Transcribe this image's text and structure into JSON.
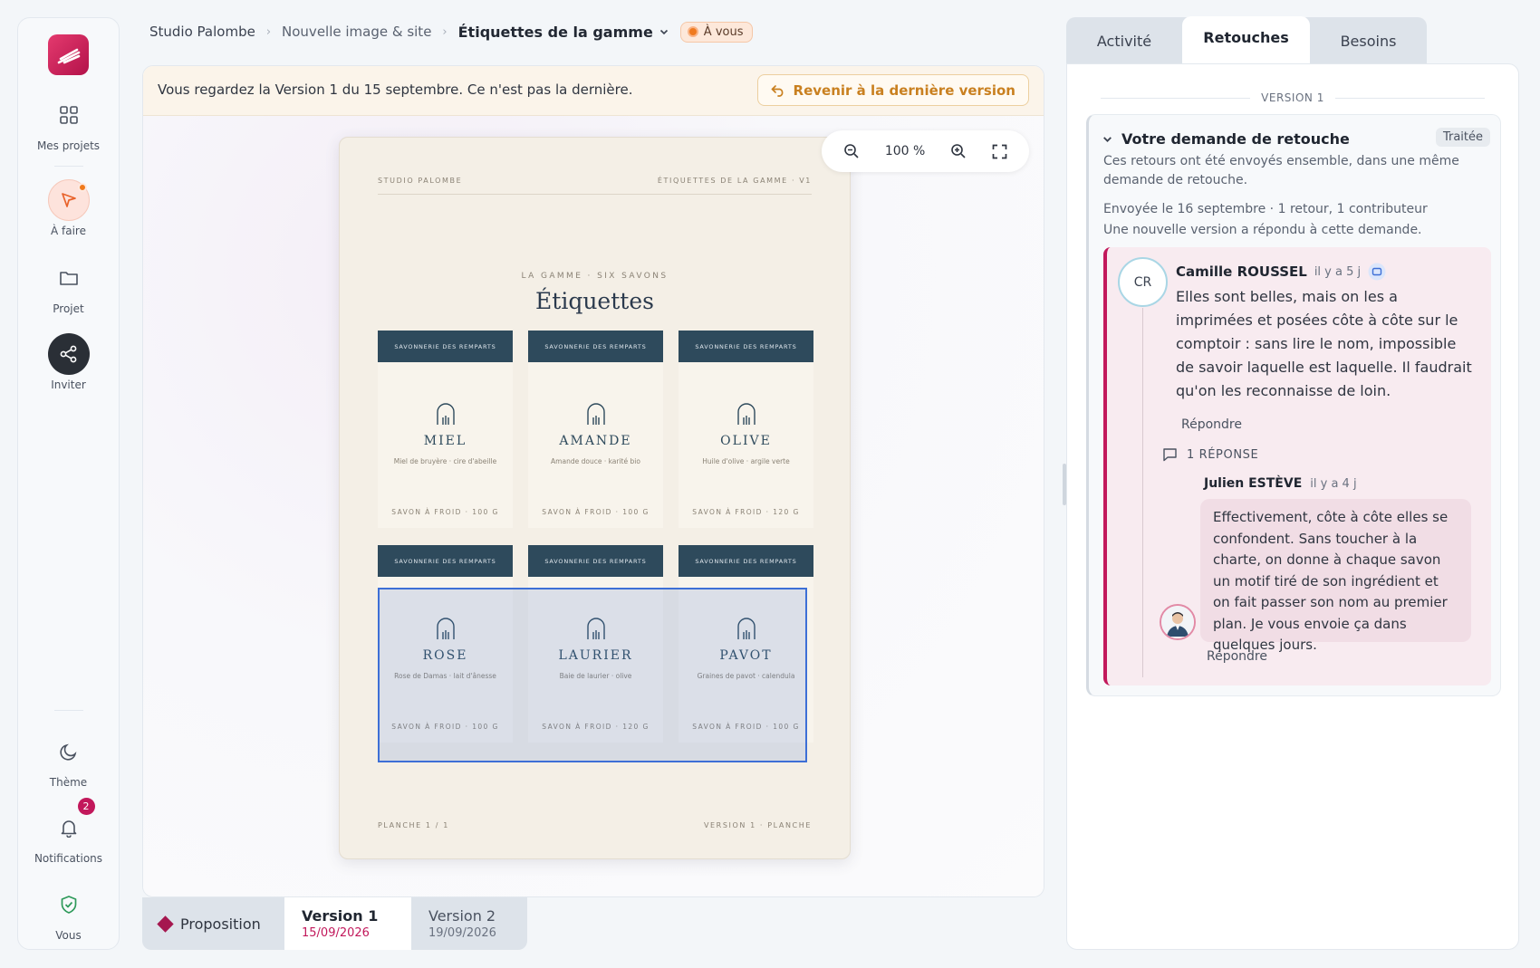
{
  "sidebar": {
    "items": [
      {
        "label": "Mes projets",
        "icon": "grid-icon"
      },
      {
        "label": "À faire",
        "icon": "cursor-icon"
      },
      {
        "label": "Projet",
        "icon": "folder-icon"
      },
      {
        "label": "Inviter",
        "icon": "share-icon"
      },
      {
        "label": "Thème",
        "icon": "moon-icon"
      },
      {
        "label": "Notifications",
        "icon": "bell-icon",
        "badge": "2"
      },
      {
        "label": "Vous",
        "icon": "shield-check-icon"
      }
    ]
  },
  "breadcrumb": {
    "items": [
      "Studio Palombe",
      "Nouvelle image & site",
      "Étiquettes de la gamme"
    ],
    "separator": "›",
    "status": "À vous"
  },
  "banner": {
    "text": "Vous regardez la Version 1 du 15 septembre. Ce n'est pas la dernière.",
    "button": "Revenir à la dernière version"
  },
  "zoom": {
    "level": "100 %"
  },
  "sheet": {
    "top_left": "STUDIO PALOMBE",
    "top_right": "ÉTIQUETTES DE LA GAMME · V1",
    "kicker": "LA GAMME · SIX SAVONS",
    "title": "Étiquettes",
    "bottom_left": "PLANCHE 1 / 1",
    "bottom_right": "VERSION 1 · PLANCHE",
    "labels": [
      {
        "band": "SAVONNERIE DES REMPARTS",
        "name": "MIEL",
        "sub": "Miel de bruyère · cire d'abeille",
        "foot": "SAVON À FROID · 100 G"
      },
      {
        "band": "SAVONNERIE DES REMPARTS",
        "name": "AMANDE",
        "sub": "Amande douce · karité bio",
        "foot": "SAVON À FROID · 100 G"
      },
      {
        "band": "SAVONNERIE DES REMPARTS",
        "name": "OLIVE",
        "sub": "Huile d'olive · argile verte",
        "foot": "SAVON À FROID · 120 G"
      },
      {
        "band": "SAVONNERIE DES REMPARTS",
        "name": "ROSE",
        "sub": "Rose de Damas · lait d'ânesse",
        "foot": "SAVON À FROID · 100 G"
      },
      {
        "band": "SAVONNERIE DES REMPARTS",
        "name": "LAURIER",
        "sub": "Baie de laurier · olive",
        "foot": "SAVON À FROID · 120 G"
      },
      {
        "band": "SAVONNERIE DES REMPARTS",
        "name": "PAVOT",
        "sub": "Graines de pavot · calendula",
        "foot": "SAVON À FROID · 100 G"
      }
    ]
  },
  "versions": {
    "proposition": "Proposition",
    "items": [
      {
        "title": "Version 1",
        "date": "15/09/2026"
      },
      {
        "title": "Version 2",
        "date": "19/09/2026"
      }
    ]
  },
  "panel": {
    "tabs": [
      "Activité",
      "Retouches",
      "Besoins"
    ],
    "version_header": "VERSION 1",
    "request": {
      "title": "Votre demande de retouche",
      "status": "Traitée",
      "description": "Ces retours ont été envoyés ensemble, dans une même demande de retouche.",
      "meta1": "Envoyée le 16 septembre · 1 retour, 1 contributeur",
      "meta2": "Une nouvelle version a répondu à cette demande."
    },
    "comment": {
      "initials": "CR",
      "author": "Camille ROUSSEL",
      "ago": "il y a 5 j",
      "text": "Elles sont belles, mais on les a imprimées et posées côte à côte sur le comptoir : sans lire le nom, impossible de savoir laquelle est laquelle. Il faudrait qu'on les reconnaisse de loin.",
      "reply_label": "Répondre",
      "replies_count": "1 RÉPONSE"
    },
    "reply": {
      "author": "Julien ESTÈVE",
      "ago": "il y a 4 j",
      "text": "Effectivement, côte à côte elles se confondent. Sans toucher à la charte, on donne à chaque savon un motif tiré de son ingrédient et on fait passer son nom au premier plan. Je vous envoie ça dans quelques jours.",
      "reply_label": "Répondre"
    }
  },
  "colors": {
    "accent": "#c2185b",
    "brand": "#d8245e",
    "label_band": "#2e4a5c",
    "selection": "#3d6fd6"
  }
}
